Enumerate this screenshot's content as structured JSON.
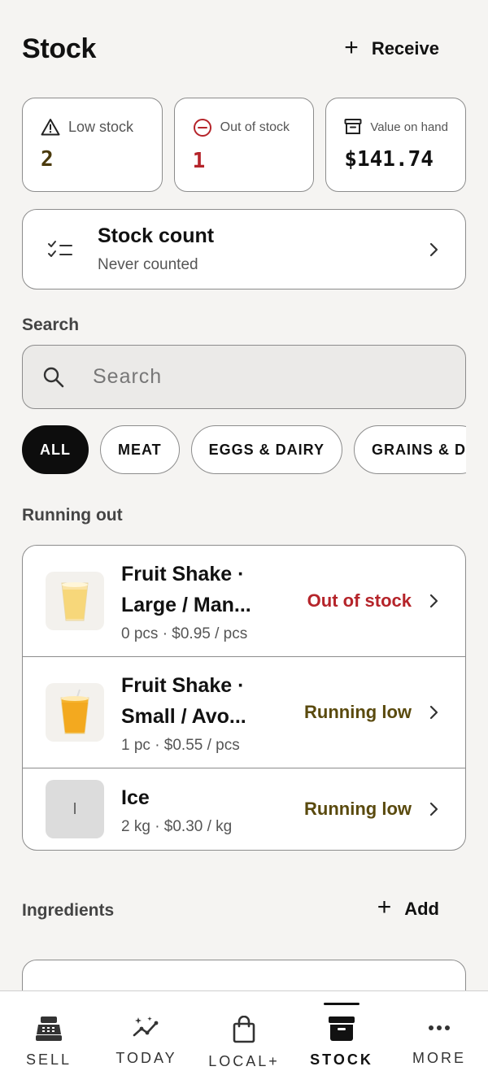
{
  "header": {
    "title": "Stock",
    "receive_label": "Receive"
  },
  "stats": {
    "low_stock": {
      "label": "Low stock",
      "value": "2"
    },
    "out_of_stock": {
      "label": "Out of stock",
      "value": "1"
    },
    "value_on_hand": {
      "label": "Value on hand",
      "value": "$141.74"
    }
  },
  "stock_count": {
    "title": "Stock count",
    "subtitle": "Never counted"
  },
  "search": {
    "label": "Search",
    "placeholder": "Search"
  },
  "chips": [
    "ALL",
    "MEAT",
    "EGGS & DAIRY",
    "GRAINS & D"
  ],
  "running_out": {
    "label": "Running out",
    "items": [
      {
        "name": "Fruit Shake ·",
        "name2": "Large / Man...",
        "meta": "0 pcs · $0.95 / pcs",
        "status": "Out of stock"
      },
      {
        "name": "Fruit Shake ·",
        "name2": "Small / Avo...",
        "meta": "1 pc · $0.55 / pcs",
        "status": "Running low"
      },
      {
        "name": "Ice",
        "meta": "2 kg · $0.30 / kg",
        "status": "Running low",
        "initial": "I"
      }
    ]
  },
  "ingredients": {
    "label": "Ingredients",
    "add_label": "Add"
  },
  "nav": {
    "items": [
      {
        "label": "SELL",
        "icon": "register-icon"
      },
      {
        "label": "TODAY",
        "icon": "sparkle-trend-icon"
      },
      {
        "label": "LOCAL+",
        "icon": "bag-icon"
      },
      {
        "label": "STOCK",
        "icon": "archive-icon"
      },
      {
        "label": "MORE",
        "icon": "more-icon"
      }
    ],
    "active": "STOCK"
  },
  "colors": {
    "out": "#b5242a",
    "low": "#5a4a0e",
    "active_chip": "#0d0d0d",
    "background": "#f5f4f2"
  }
}
